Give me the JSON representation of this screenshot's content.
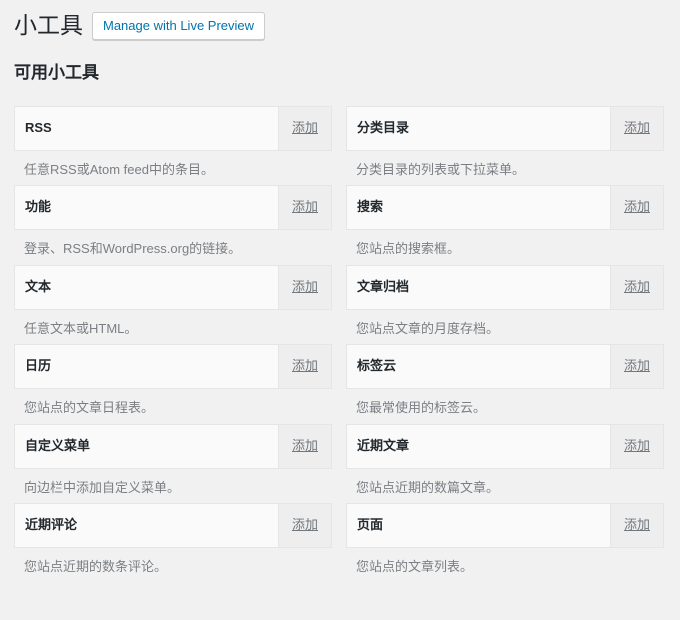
{
  "header": {
    "title": "小工具",
    "live_preview_label": "Manage with Live Preview"
  },
  "section": {
    "heading": "可用小工具"
  },
  "colors": {
    "page_background": "#f1f1f1",
    "card_background": "#fafafa",
    "card_border": "#e5e5e5",
    "action_background": "#eeeeee",
    "link_blue": "#0073aa",
    "title_text": "#23282d",
    "description_text": "#7b7f84",
    "action_text": "#72777c"
  },
  "add_label": "添加",
  "columns": [
    {
      "name": "left-column",
      "widgets": [
        {
          "title": "RSS",
          "description": "任意RSS或Atom feed中的条目。",
          "add_label": "添加"
        },
        {
          "title": "功能",
          "description": "登录、RSS和WordPress.org的链接。",
          "add_label": "添加"
        },
        {
          "title": "文本",
          "description": "任意文本或HTML。",
          "add_label": "添加"
        },
        {
          "title": "日历",
          "description": "您站点的文章日程表。",
          "add_label": "添加"
        },
        {
          "title": "自定义菜单",
          "description": "向边栏中添加自定义菜单。",
          "add_label": "添加"
        },
        {
          "title": "近期评论",
          "description": "您站点近期的数条评论。",
          "add_label": "添加"
        }
      ]
    },
    {
      "name": "right-column",
      "widgets": [
        {
          "title": "分类目录",
          "description": "分类目录的列表或下拉菜单。",
          "add_label": "添加"
        },
        {
          "title": "搜索",
          "description": "您站点的搜索框。",
          "add_label": "添加"
        },
        {
          "title": "文章归档",
          "description": "您站点文章的月度存档。",
          "add_label": "添加"
        },
        {
          "title": "标签云",
          "description": "您最常使用的标签云。",
          "add_label": "添加"
        },
        {
          "title": "近期文章",
          "description": "您站点近期的数篇文章。",
          "add_label": "添加"
        },
        {
          "title": "页面",
          "description": "您站点的文章列表。",
          "add_label": "添加"
        }
      ]
    }
  ]
}
